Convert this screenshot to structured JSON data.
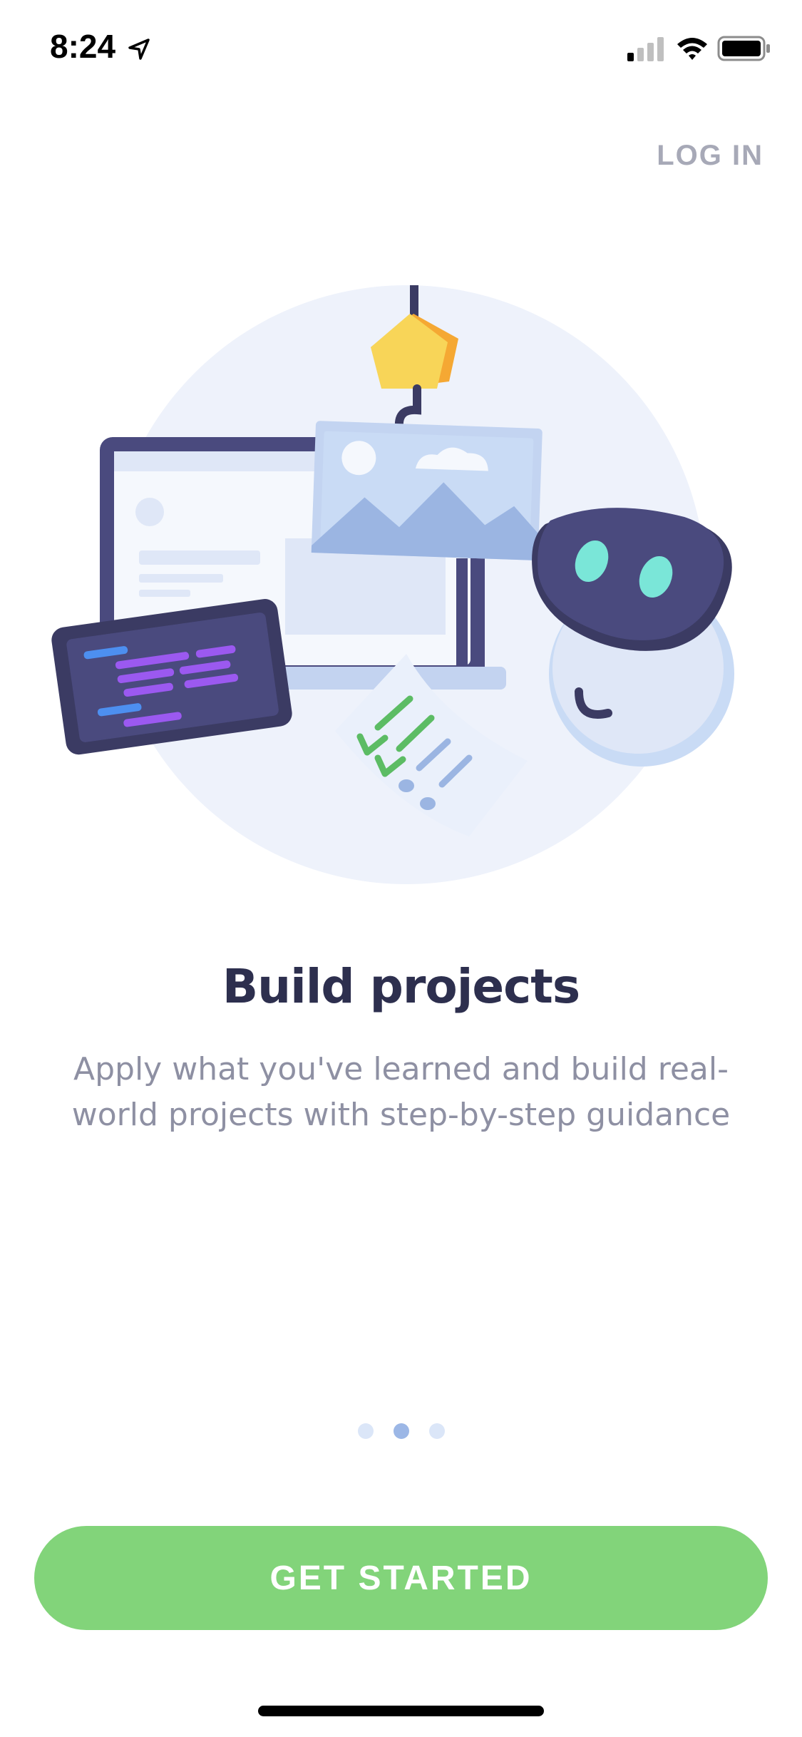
{
  "status_bar": {
    "time": "8:24",
    "location_icon": "location-arrow-icon",
    "signal_icon": "cellular-signal-icon",
    "wifi_icon": "wifi-icon",
    "battery_icon": "battery-icon"
  },
  "header": {
    "login_label": "LOG IN"
  },
  "illustration": {
    "name": "build-projects-illustration"
  },
  "onboarding": {
    "title": "Build projects",
    "subtitle": "Apply what you've learned and build real-world projects with step-by-step guidance",
    "page_count": 3,
    "current_page": 2
  },
  "cta": {
    "label": "GET STARTED",
    "color": "#82d47a"
  },
  "colors": {
    "accent_green": "#82d47a",
    "title": "#2d2f4e",
    "subtitle": "#8e90a3",
    "login": "#a7a9b7",
    "dot_active": "#9cb7e6",
    "dot_inactive": "#dbe6f8"
  }
}
